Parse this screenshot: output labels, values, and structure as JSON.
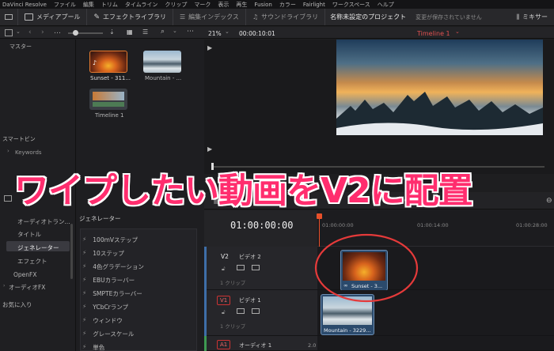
{
  "menubar": {
    "items": [
      "DaVinci Resolve",
      "ファイル",
      "編集",
      "トリム",
      "タイムライン",
      "クリップ",
      "マーク",
      "表示",
      "再生",
      "Fusion",
      "カラー",
      "Fairlight",
      "ワークスペース",
      "ヘルプ"
    ]
  },
  "toolbar": {
    "media_pool": "メディアプール",
    "effects_library": "エフェクトライブラリ",
    "edit_index": "編集インデックス",
    "sound_library": "サウンドライブラリ",
    "project_name": "名称未設定のプロジェクト",
    "save_status": "変更が保存されていません",
    "mixer": "ミキサー"
  },
  "viewer": {
    "zoom": "21%",
    "timecode": "00:00:10:01",
    "timeline_name": "Timeline 1"
  },
  "media_pool": {
    "master_label": "マスター",
    "smart_bins_label": "スマートビン",
    "keywords_label": "Keywords",
    "clips": [
      {
        "name": "Sunset - 311...",
        "kind": "sunset"
      },
      {
        "name": "Mountain - ...",
        "kind": "mountain"
      },
      {
        "name": "Timeline 1",
        "kind": "timeline"
      }
    ]
  },
  "overlay_caption": "ワイプしたい動画をV2に配置",
  "effects": {
    "nav_items": [
      "オーディオトラン...",
      "タイトル",
      "ジェネレーター",
      "エフェクト",
      "OpenFX",
      "オーディオFX",
      "お気に入り"
    ],
    "selected_nav": "ジェネレーター",
    "list_title": "ジェネレーター",
    "items": [
      "100mVステップ",
      "10ステップ",
      "4色グラデーション",
      "EBUカラーバー",
      "SMPTEカラーバー",
      "YCbCrランプ",
      "ウィンドウ",
      "グレースケール",
      "単色"
    ]
  },
  "timeline": {
    "timecode": "01:00:00:00",
    "ruler": [
      "01:00:00:00",
      "01:00:14:00",
      "01:00:28:00"
    ],
    "tracks": [
      {
        "id": "V2",
        "name": "ビデオ 2",
        "count": "1 クリップ",
        "clip": "Sunset - 3..."
      },
      {
        "id": "V1",
        "name": "ビデオ 1",
        "count": "1 クリップ",
        "clip": "Mountain - 3229..."
      },
      {
        "id": "A1",
        "name": "オーディオ 1",
        "level": "2.0"
      }
    ]
  },
  "colors": {
    "accent_red": "#e53a3a",
    "caption": "#ff2d6e",
    "playhead": "#e8502a"
  }
}
